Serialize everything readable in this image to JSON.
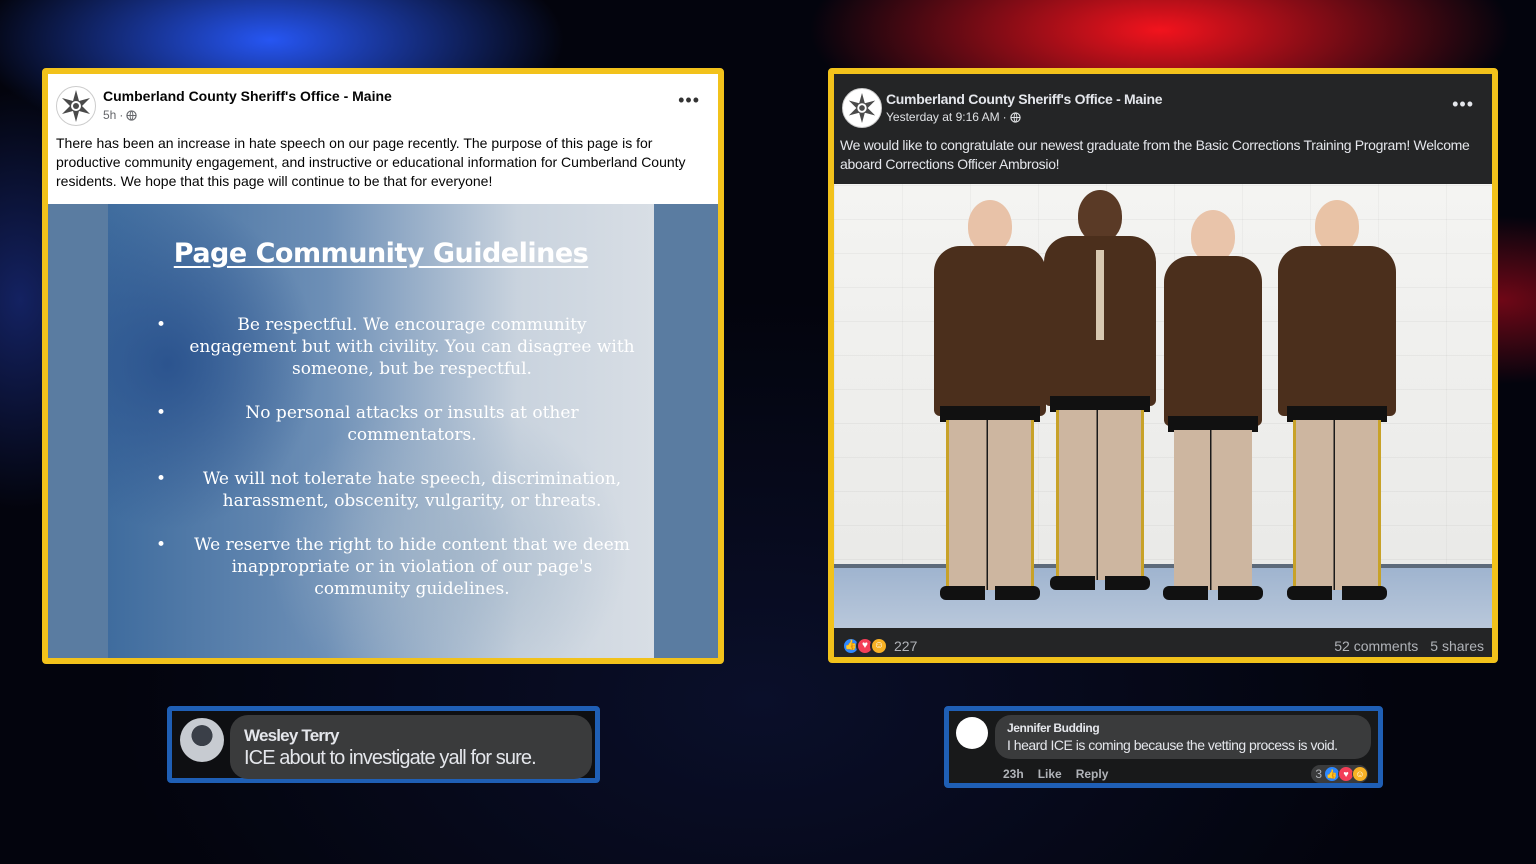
{
  "colors": {
    "card_border": "#f2c21b",
    "comment_border": "#1f5fb5",
    "like_blue": "#2d88ff",
    "love_red": "#f33e58",
    "haha_yellow": "#f7b125"
  },
  "left_post": {
    "page_name": "Cumberland County Sheriff's Office - Maine",
    "time": "5h",
    "privacy_icon": "globe-icon",
    "more_icon": "more-options-icon",
    "more_glyph": "•••",
    "caption": "There has been an increase in hate speech on our page recently. The purpose of this page is for productive community engagement,  and instructive or educational information for Cumberland County residents. We hope that this page will continue to be that for everyone!",
    "image": {
      "title": "Page Community Guidelines",
      "items": [
        "Be respectful. We encourage community engagement but with civility. You can disagree with someone, but be respectful.",
        "No personal attacks or insults at other commentators.",
        "We will not tolerate hate speech, discrimination, harassment, obscenity, vulgarity, or threats.",
        "We reserve the right to hide content that we deem inappropriate or in violation of our page's community guidelines."
      ]
    }
  },
  "right_post": {
    "page_name": "Cumberland County Sheriff's Office - Maine",
    "time": "Yesterday at 9:16 AM",
    "privacy_icon": "globe-icon",
    "more_glyph": "•••",
    "caption": "We would like to congratulate our newest graduate from the Basic Corrections Training Program! Welcome aboard Corrections Officer Ambrosio!",
    "reaction_count": "227",
    "comments": "52 comments",
    "shares": "5 shares"
  },
  "comment_left": {
    "name": "Wesley Terry",
    "text": "ICE about to investigate yall for sure."
  },
  "comment_right": {
    "name": "Jennifer Budding",
    "text": "I heard ICE is coming because the vetting process is void.",
    "time": "23h",
    "like": "Like",
    "reply": "Reply",
    "reaction_count": "3"
  }
}
